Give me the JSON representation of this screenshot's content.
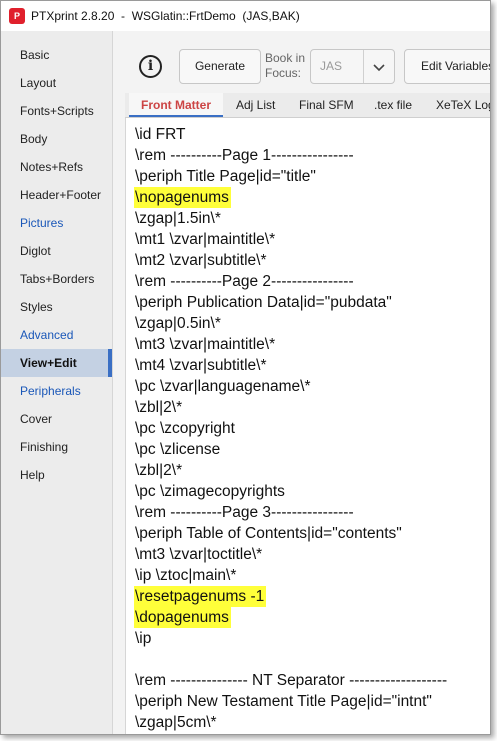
{
  "window": {
    "title": "PTXprint 2.8.20  -  WSGlatin::FrtDemo  (JAS,BAK)",
    "icon": "ptxprint-app-icon",
    "icon_text": "P"
  },
  "sidebar": {
    "items": [
      {
        "label": "Basic",
        "style": "normal"
      },
      {
        "label": "Layout",
        "style": "normal"
      },
      {
        "label": "Fonts+Scripts",
        "style": "normal"
      },
      {
        "label": "Body",
        "style": "normal"
      },
      {
        "label": "Notes+Refs",
        "style": "normal"
      },
      {
        "label": "Header+Footer",
        "style": "normal"
      },
      {
        "label": "Pictures",
        "style": "blue"
      },
      {
        "label": "Diglot",
        "style": "normal"
      },
      {
        "label": "Tabs+Borders",
        "style": "normal"
      },
      {
        "label": "Styles",
        "style": "normal"
      },
      {
        "label": "Advanced",
        "style": "blue"
      },
      {
        "label": "View+Edit",
        "style": "active"
      },
      {
        "label": "Peripherals",
        "style": "blue"
      },
      {
        "label": "Cover",
        "style": "normal"
      },
      {
        "label": "Finishing",
        "style": "normal"
      },
      {
        "label": "Help",
        "style": "normal"
      }
    ]
  },
  "toolbar": {
    "info_icon": "info-circle-icon",
    "info_symbol": "i",
    "generate_label": "Generate",
    "book_label_line1": "Book in",
    "book_label_line2": "Focus:",
    "book_value": "JAS",
    "dropdown_icon": "chevron-down-icon",
    "edit_variables_label": "Edit Variables"
  },
  "tabs": [
    {
      "label": "Front Matter",
      "active": true
    },
    {
      "label": "Adj List",
      "active": false
    },
    {
      "label": "Final SFM",
      "active": false
    },
    {
      "label": ".tex file",
      "active": false
    },
    {
      "label": "XeTeX Log",
      "active": false
    }
  ],
  "editor": {
    "highlight_color": "#ffff3a",
    "lines": [
      {
        "text": "\\id FRT",
        "highlight": false
      },
      {
        "text": "\\rem ----------Page 1----------------",
        "highlight": false
      },
      {
        "text": "\\periph Title Page|id=\"title\"",
        "highlight": false
      },
      {
        "text": "\\nopagenums",
        "highlight": true
      },
      {
        "text": "\\zgap|1.5in\\*",
        "highlight": false
      },
      {
        "text": "\\mt1 \\zvar|maintitle\\*",
        "highlight": false
      },
      {
        "text": "\\mt2 \\zvar|subtitle\\*",
        "highlight": false
      },
      {
        "text": "\\rem ----------Page 2----------------",
        "highlight": false
      },
      {
        "text": "\\periph Publication Data|id=\"pubdata\"",
        "highlight": false
      },
      {
        "text": "\\zgap|0.5in\\*",
        "highlight": false
      },
      {
        "text": "\\mt3 \\zvar|maintitle\\*",
        "highlight": false
      },
      {
        "text": "\\mt4 \\zvar|subtitle\\*",
        "highlight": false
      },
      {
        "text": "\\pc \\zvar|languagename\\*",
        "highlight": false
      },
      {
        "text": "\\zbl|2\\*",
        "highlight": false
      },
      {
        "text": "\\pc \\zcopyright",
        "highlight": false
      },
      {
        "text": "\\pc \\zlicense",
        "highlight": false
      },
      {
        "text": "\\zbl|2\\*",
        "highlight": false
      },
      {
        "text": "\\pc \\zimagecopyrights",
        "highlight": false
      },
      {
        "text": "\\rem ----------Page 3----------------",
        "highlight": false
      },
      {
        "text": "\\periph Table of Contents|id=\"contents\"",
        "highlight": false
      },
      {
        "text": "\\mt3 \\zvar|toctitle\\*",
        "highlight": false
      },
      {
        "text": "\\ip \\ztoc|main\\*",
        "highlight": false
      },
      {
        "text": "\\resetpagenums -1",
        "highlight": true
      },
      {
        "text": "\\dopagenums",
        "highlight": true
      },
      {
        "text": "\\ip",
        "highlight": false
      },
      {
        "text": "",
        "highlight": false
      },
      {
        "text": "\\rem --------------- NT Separator -------------------",
        "highlight": false
      },
      {
        "text": "\\periph New Testament Title Page|id=\"intnt\"",
        "highlight": false
      },
      {
        "text": "\\zgap|5cm\\*",
        "highlight": false
      }
    ]
  }
}
